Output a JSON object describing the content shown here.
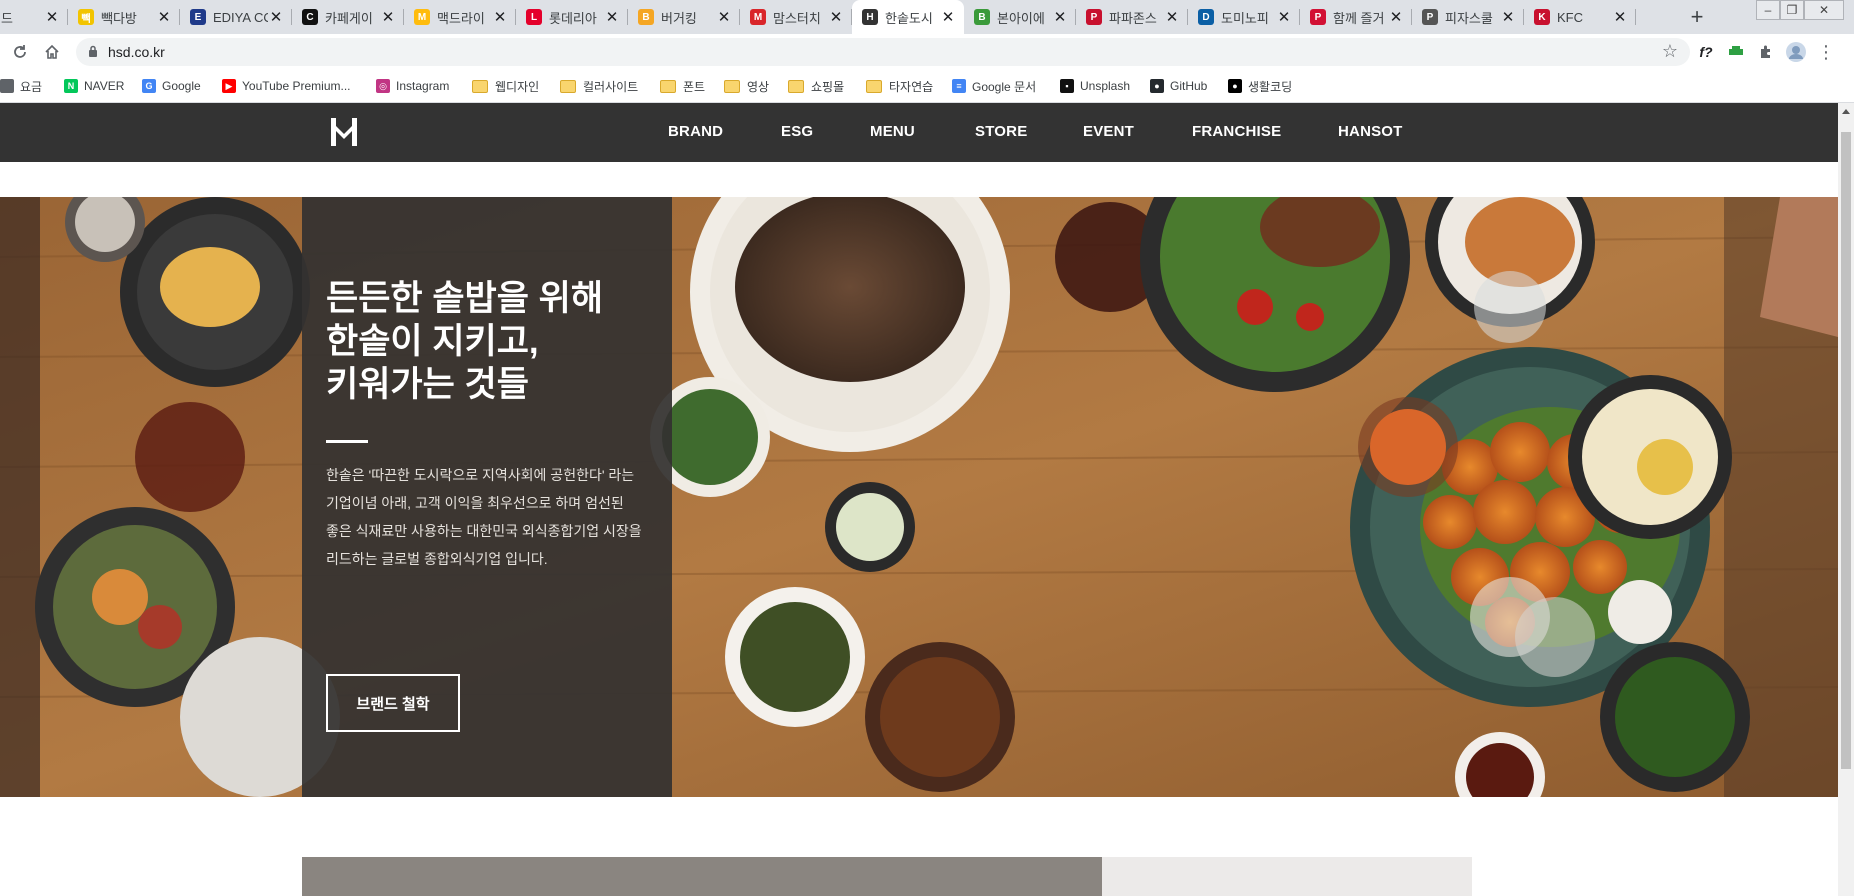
{
  "browser": {
    "tabs": [
      {
        "label": "에드",
        "color": "#5b7fbf",
        "glyph": "e"
      },
      {
        "label": "빽다방",
        "color": "#f2c400",
        "glyph": "빽"
      },
      {
        "label": "EDIYA CO",
        "color": "#1f3a8a",
        "glyph": "E"
      },
      {
        "label": "카페게이",
        "color": "#111111",
        "glyph": "C"
      },
      {
        "label": "맥드라이",
        "color": "#ffbc0d",
        "glyph": "M"
      },
      {
        "label": "롯데리아",
        "color": "#e4002b",
        "glyph": "L"
      },
      {
        "label": "버거킹",
        "color": "#f5a623",
        "glyph": "B"
      },
      {
        "label": "맘스터치",
        "color": "#d9252a",
        "glyph": "M"
      },
      {
        "label": "한솥도시",
        "color": "#333333",
        "glyph": "H"
      },
      {
        "label": "본아이에",
        "color": "#3a9a3a",
        "glyph": "B"
      },
      {
        "label": "파파존스",
        "color": "#c8102e",
        "glyph": "P"
      },
      {
        "label": "도미노피",
        "color": "#0b5fa5",
        "glyph": "D"
      },
      {
        "label": "함께 즐거",
        "color": "#d21034",
        "glyph": "P"
      },
      {
        "label": "피자스쿨",
        "color": "#555555",
        "glyph": "P"
      },
      {
        "label": "KFC",
        "color": "#c8102e",
        "glyph": "K"
      }
    ],
    "active_tab_index": 8,
    "new_tab": "+",
    "url": "hsd.co.kr",
    "bookmarks": [
      {
        "label": "요금",
        "type": "site",
        "color": "#5f6368"
      },
      {
        "label": "NAVER",
        "type": "site",
        "color": "#03c75a",
        "glyph": "N"
      },
      {
        "label": "Google",
        "type": "site",
        "color": "#4285f4",
        "glyph": "G"
      },
      {
        "label": "YouTube Premium...",
        "type": "site",
        "color": "#ff0000",
        "glyph": "▶"
      },
      {
        "label": "Instagram",
        "type": "site",
        "color": "#c13584",
        "glyph": "◎"
      },
      {
        "label": "웹디자인",
        "type": "folder"
      },
      {
        "label": "컬러사이트",
        "type": "folder"
      },
      {
        "label": "폰트",
        "type": "folder"
      },
      {
        "label": "영상",
        "type": "folder"
      },
      {
        "label": "쇼핑몰",
        "type": "folder"
      },
      {
        "label": "타자연습",
        "type": "folder"
      },
      {
        "label": "Google 문서",
        "type": "site",
        "color": "#4285f4",
        "glyph": "≡"
      },
      {
        "label": "Unsplash",
        "type": "site",
        "color": "#111111",
        "glyph": "▪"
      },
      {
        "label": "GitHub",
        "type": "site",
        "color": "#24292e",
        "glyph": "●"
      },
      {
        "label": "생활코딩",
        "type": "site",
        "color": "#000000",
        "glyph": "●"
      }
    ]
  },
  "site": {
    "nav": [
      "BRAND",
      "ESG",
      "MENU",
      "STORE",
      "EVENT",
      "FRANCHISE",
      "HANSOT"
    ],
    "hero": {
      "headline_lines": [
        "든든한 솥밥을 위해",
        "한솥이 지키고,",
        "키워가는 것들"
      ],
      "description_lines": [
        "한솥은 '따끈한 도시락으로 지역사회에 공헌한다' 라는",
        "기업이념 아래, 고객 이익을 최우선으로 하며 엄선된",
        "좋은 식재료만 사용하는 대한민국 외식종합기업 시장을",
        "리드하는 글로벌 종합외식기업 입니다."
      ],
      "button": "브랜드 철학"
    }
  },
  "colors": {
    "nav_bg": "#333333",
    "panel_bg": "#343230",
    "wood": "#8b5a30"
  }
}
